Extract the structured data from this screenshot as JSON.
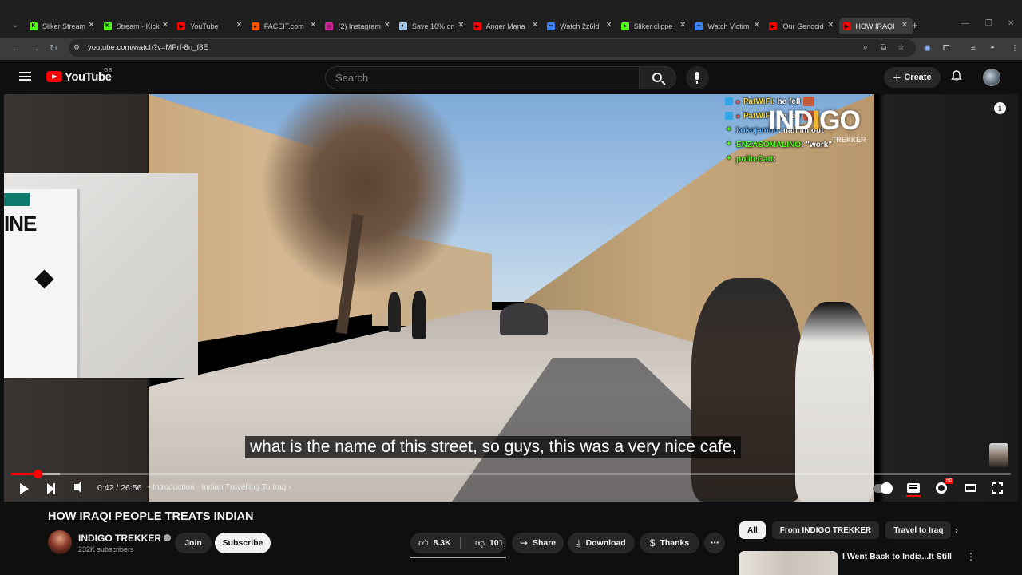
{
  "browser": {
    "tabs": [
      {
        "title": "Sliker Stream",
        "favicon_color": "#53fc18",
        "favicon_glyph": "K",
        "active": false
      },
      {
        "title": "Stream - Kick",
        "favicon_color": "#53fc18",
        "favicon_glyph": "K",
        "active": false
      },
      {
        "title": "YouTube",
        "favicon_color": "#ff0000",
        "favicon_glyph": "▶",
        "active": false
      },
      {
        "title": "FACEIT.com",
        "favicon_color": "#ff5500",
        "favicon_glyph": "▸",
        "active": false
      },
      {
        "title": "(2) Instagram",
        "favicon_color": "#d6249f",
        "favicon_glyph": "◎",
        "active": false
      },
      {
        "title": "Save 10% on",
        "favicon_color": "#9fc4e7",
        "favicon_glyph": "◐",
        "active": false
      },
      {
        "title": "Anger Mana",
        "favicon_color": "#ff0000",
        "favicon_glyph": "▶",
        "active": false
      },
      {
        "title": "Watch 2z6ld",
        "favicon_color": "#3b82f6",
        "favicon_glyph": "∞",
        "active": false
      },
      {
        "title": "Sliker clippe",
        "favicon_color": "#53fc18",
        "favicon_glyph": "✦",
        "active": false
      },
      {
        "title": "Watch Victim",
        "favicon_color": "#3b82f6",
        "favicon_glyph": "∞",
        "active": false
      },
      {
        "title": "'Our Genocid",
        "favicon_color": "#ff0000",
        "favicon_glyph": "▶",
        "active": false
      },
      {
        "title": "HOW IRAQI",
        "favicon_color": "#ff0000",
        "favicon_glyph": "▶",
        "active": true
      }
    ],
    "url": "youtube.com/watch?v=MPrf-8n_f8E"
  },
  "masthead": {
    "logo_text": "YouTube",
    "country_code": "GB",
    "search_placeholder": "Search",
    "create_label": "Create"
  },
  "player": {
    "chat": [
      {
        "user": "PatWiFi",
        "message": " : he fell",
        "user_color": "#f5d742",
        "badge": "blue",
        "emote": true
      },
      {
        "user": "PatWiFi",
        "message": " : he fell",
        "user_color": "#f5d742",
        "badge": "blue",
        "emote": true
      },
      {
        "user": "kokojambo",
        "message": " : nah im out",
        "user_color": "#6fb8ff",
        "badge": "green",
        "emote": false
      },
      {
        "user": "ENZASOMALINO",
        "message": " : \"work\"",
        "user_color": "#53fc18",
        "badge": "green",
        "emote": false
      },
      {
        "user": "politeCatt",
        "message": " : ",
        "user_color": "#53fc18",
        "badge": "green",
        "emote": false
      }
    ],
    "watermark_left": "IND",
    "watermark_accent": "I",
    "watermark_right": "GO",
    "watermark_sub": "TREKKER",
    "pip_text": "INE",
    "caption": "what is the name of this street, so guys, this was a very nice cafe,",
    "time_current": "0:42",
    "time_total": "26:56",
    "time_display": "0:42 / 26:56",
    "chapter": "Introduction - Indian Travelling To Iraq",
    "played_fraction": 0.026,
    "buffered_fraction": 0.049,
    "quality_badge": "HD"
  },
  "video": {
    "title": "HOW IRAQI PEOPLE TREATS INDIAN",
    "channel_name": "INDIGO TREKKER",
    "subscribers": "232K subscribers",
    "join_label": "Join",
    "subscribe_label": "Subscribe",
    "likes": "8.3K",
    "dislikes": "101",
    "share_label": "Share",
    "download_label": "Download",
    "thanks_label": "Thanks"
  },
  "sidebar": {
    "chips": [
      "All",
      "From INDIGO TREKKER",
      "Travel to Iraq"
    ],
    "first_recommendation_title": "I Went Back to India...It Still"
  },
  "colors": {
    "brand_red": "#ff0000",
    "background": "#0f0f0f",
    "kick_green": "#53fc18"
  }
}
